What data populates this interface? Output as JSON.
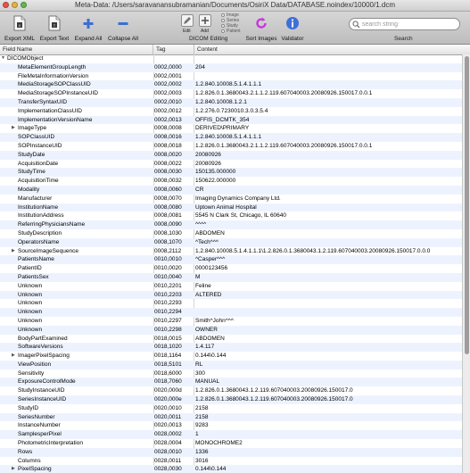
{
  "window": {
    "title": "Meta-Data: /Users/saravanansubramanian/Documents/OsiriX Data/DATABASE.noindex/10000/1.dcm"
  },
  "toolbar": {
    "export_xml": "Export XML",
    "export_text": "Export Text",
    "expand_all": "Expand All",
    "collapse_all": "Collapse All",
    "edit": "Edit",
    "add": "Add",
    "dicom_editing": "DICOM Editing",
    "radio_options": [
      "Image",
      "Series",
      "Study",
      "Patient"
    ],
    "sort_images": "Sort Images",
    "validator": "Validator",
    "search_label": "Search",
    "search_placeholder": "search string"
  },
  "columns": {
    "field": "Field Name",
    "tag": "Tag",
    "content": "Content"
  },
  "rows": [
    {
      "field": "DICOMObject",
      "tag": "",
      "content": "",
      "level": 0,
      "expandable": true
    },
    {
      "field": "MetaElementGroupLength",
      "tag": "0002,0000",
      "content": "204",
      "level": 1
    },
    {
      "field": "FileMetaInformationVersion",
      "tag": "0002,0001",
      "content": "",
      "level": 1
    },
    {
      "field": "MediaStorageSOPClassUID",
      "tag": "0002,0002",
      "content": "1.2.840.10008.5.1.4.1.1.1",
      "level": 1
    },
    {
      "field": "MediaStorageSOPInstanceUID",
      "tag": "0002,0003",
      "content": "1.2.826.0.1.3680043.2.1.1.2.119.607040003.20080926.150017.0.0.1",
      "level": 1
    },
    {
      "field": "TransferSyntaxUID",
      "tag": "0002,0010",
      "content": "1.2.840.10008.1.2.1",
      "level": 1
    },
    {
      "field": "ImplementationClassUID",
      "tag": "0002,0012",
      "content": "1.2.276.0.7230010.3.0.3.5.4",
      "level": 1
    },
    {
      "field": "ImplementationVersionName",
      "tag": "0002,0013",
      "content": "OFFIS_DCMTK_354",
      "level": 1
    },
    {
      "field": "ImageType",
      "tag": "0008,0008",
      "content": "DERIVED\\PRIMARY",
      "level": 1,
      "expandable": true
    },
    {
      "field": "SOPClassUID",
      "tag": "0008,0016",
      "content": "1.2.840.10008.5.1.4.1.1.1",
      "level": 1
    },
    {
      "field": "SOPInstanceUID",
      "tag": "0008,0018",
      "content": "1.2.826.0.1.3680043.2.1.1.2.119.607040003.20080926.150017.0.0.1",
      "level": 1
    },
    {
      "field": "StudyDate",
      "tag": "0008,0020",
      "content": "20080926",
      "level": 1
    },
    {
      "field": "AcquisitionDate",
      "tag": "0008,0022",
      "content": "20080926",
      "level": 1
    },
    {
      "field": "StudyTime",
      "tag": "0008,0030",
      "content": "150135.000000",
      "level": 1
    },
    {
      "field": "AcquisitionTime",
      "tag": "0008,0032",
      "content": "150622.000000",
      "level": 1
    },
    {
      "field": "Modality",
      "tag": "0008,0060",
      "content": "CR",
      "level": 1
    },
    {
      "field": "Manufacturer",
      "tag": "0008,0070",
      "content": "Imaging Dynamics Company Ltd.",
      "level": 1
    },
    {
      "field": "InstitutionName",
      "tag": "0008,0080",
      "content": "Uptown Animal Hospital",
      "level": 1
    },
    {
      "field": "InstitutionAddress",
      "tag": "0008,0081",
      "content": "5545 N Clark St, Chicago, IL 60640",
      "level": 1
    },
    {
      "field": "ReferringPhysiciansName",
      "tag": "0008,0090",
      "content": "^^^^",
      "level": 1
    },
    {
      "field": "StudyDescription",
      "tag": "0008,1030",
      "content": "ABDOMEN",
      "level": 1
    },
    {
      "field": "OperatorsName",
      "tag": "0008,1070",
      "content": "^Tech^^^",
      "level": 1
    },
    {
      "field": "SourceImageSequence",
      "tag": "0008,2112",
      "content": "1.2.840.10008.5.1.4.1.1.1\\1.2.826.0.1.3680043.1.2.119.607040003.20080926.150017.0.0.0",
      "level": 1,
      "expandable": true
    },
    {
      "field": "PatientsName",
      "tag": "0010,0010",
      "content": "^Casper^^^",
      "level": 1
    },
    {
      "field": "PatientID",
      "tag": "0010,0020",
      "content": "0000123456",
      "level": 1
    },
    {
      "field": "PatientsSex",
      "tag": "0010,0040",
      "content": "M",
      "level": 1
    },
    {
      "field": "Unknown",
      "tag": "0010,2201",
      "content": "Feline",
      "level": 1
    },
    {
      "field": "Unknown",
      "tag": "0010,2203",
      "content": "ALTERED",
      "level": 1
    },
    {
      "field": "Unknown",
      "tag": "0010,2293",
      "content": "",
      "level": 1
    },
    {
      "field": "Unknown",
      "tag": "0010,2294",
      "content": "",
      "level": 1
    },
    {
      "field": "Unknown",
      "tag": "0010,2297",
      "content": "Smith^John^^^",
      "level": 1
    },
    {
      "field": "Unknown",
      "tag": "0010,2298",
      "content": "OWNER",
      "level": 1
    },
    {
      "field": "BodyPartExamined",
      "tag": "0018,0015",
      "content": "ABDOMEN",
      "level": 1
    },
    {
      "field": "SoftwareVersions",
      "tag": "0018,1020",
      "content": "1.4.117",
      "level": 1
    },
    {
      "field": "ImagerPixelSpacing",
      "tag": "0018,1164",
      "content": "0.144\\0.144",
      "level": 1,
      "expandable": true
    },
    {
      "field": "ViewPosition",
      "tag": "0018,5101",
      "content": "RL",
      "level": 1
    },
    {
      "field": "Sensitivity",
      "tag": "0018,6000",
      "content": "300",
      "level": 1
    },
    {
      "field": "ExposureControlMode",
      "tag": "0018,7060",
      "content": "MANUAL",
      "level": 1
    },
    {
      "field": "StudyInstanceUID",
      "tag": "0020,000d",
      "content": "1.2.826.0.1.3680043.1.2.119.607040003.20080926.150017.0",
      "level": 1
    },
    {
      "field": "SeriesInstanceUID",
      "tag": "0020,000e",
      "content": "1.2.826.0.1.3680043.1.2.119.607040003.20080926.150017.0",
      "level": 1
    },
    {
      "field": "StudyID",
      "tag": "0020,0010",
      "content": "2158",
      "level": 1
    },
    {
      "field": "SeriesNumber",
      "tag": "0020,0011",
      "content": "2158",
      "level": 1
    },
    {
      "field": "InstanceNumber",
      "tag": "0020,0013",
      "content": "9283",
      "level": 1
    },
    {
      "field": "SamplesperPixel",
      "tag": "0028,0002",
      "content": "1",
      "level": 1
    },
    {
      "field": "PhotometricInterpretation",
      "tag": "0028,0004",
      "content": "MONOCHROME2",
      "level": 1
    },
    {
      "field": "Rows",
      "tag": "0028,0010",
      "content": "1336",
      "level": 1
    },
    {
      "field": "Columns",
      "tag": "0028,0011",
      "content": "3016",
      "level": 1
    },
    {
      "field": "PixelSpacing",
      "tag": "0028,0030",
      "content": "0.144\\0.144",
      "level": 1,
      "expandable": true
    }
  ],
  "colors": {
    "stripe": "#edf3fe",
    "add_icon": "#3b6fcf",
    "sort_icon": "#c43ad8",
    "validator_icon": "#3f6fd8"
  },
  "icons": {
    "export_xml": "document-icon",
    "export_text": "document-icon",
    "expand_all": "plus-icon",
    "collapse_all": "minus-icon",
    "edit": "pencil-icon",
    "add": "add-icon",
    "sort_images": "sort-icon",
    "validator": "info-icon",
    "search": "magnifier-icon"
  },
  "scroll": {
    "position": 0,
    "visible_fraction": 0.72
  }
}
